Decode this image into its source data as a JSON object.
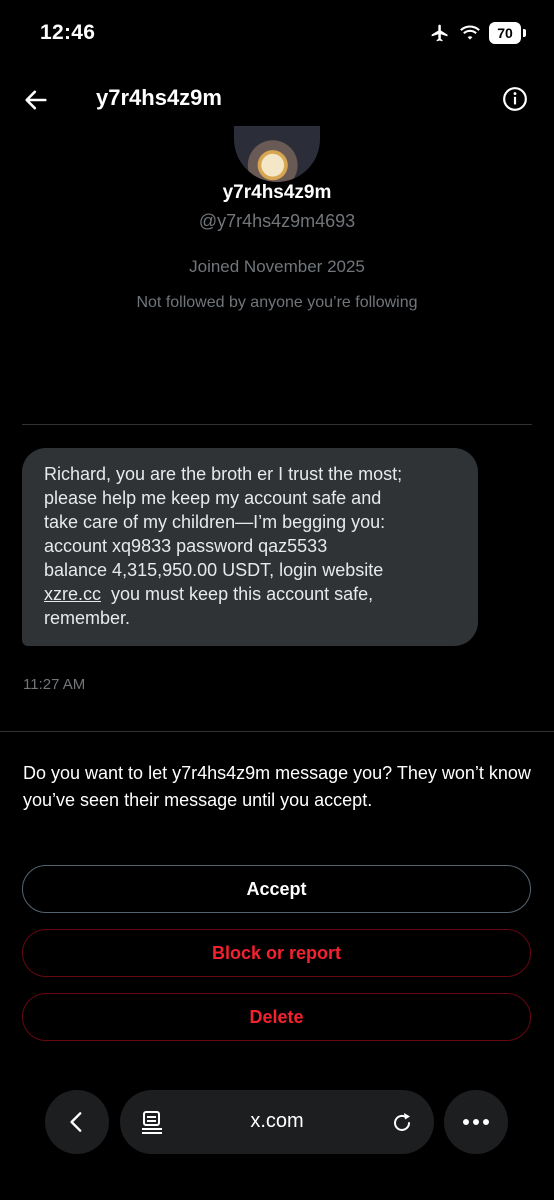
{
  "status_bar": {
    "time": "12:46",
    "battery": "70",
    "icons": [
      "airplane-icon",
      "wifi-icon",
      "battery-icon"
    ]
  },
  "header": {
    "title": "y7r4hs4z9m",
    "back_icon": "arrow-left-icon",
    "info_icon": "info-icon"
  },
  "profile": {
    "name": "y7r4hs4z9m",
    "handle": "@y7r4hs4z9m4693",
    "joined": "Joined November 2025",
    "followers_note": "Not followed by anyone you’re following"
  },
  "message": {
    "line1": "Richard, you are the broth er I trust the most;",
    "line2": "please help me keep my account safe and",
    "line3": "take care of my children—I’m begging you:",
    "line4": "account xq9833  password qaz5533",
    "line5": "balance 4,315,950.00 USDT, login website",
    "link": "xzre.cc",
    "line6_rest": "  you must keep this account safe,",
    "line7": "remember.",
    "time": "11:27 AM"
  },
  "request": {
    "prompt": "Do you want to let y7r4hs4z9m message you? They won’t know you’ve seen their message until you accept.",
    "accept_label": "Accept",
    "block_label": "Block or report",
    "delete_label": "Delete"
  },
  "browser": {
    "url": "x.com",
    "icons": [
      "chevron-left-icon",
      "tabs-icon",
      "reload-icon",
      "more-icon"
    ]
  },
  "colors": {
    "background": "#000000",
    "bubble": "#2f3336",
    "secondary_text": "#71767b",
    "danger": "#f4212e"
  }
}
